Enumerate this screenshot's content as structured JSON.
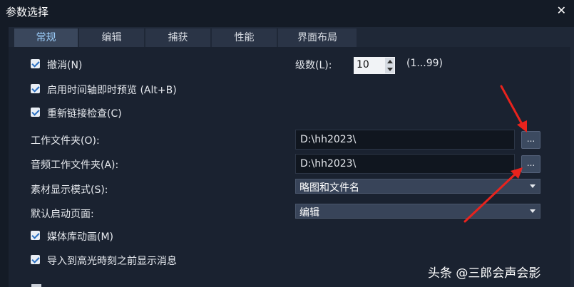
{
  "window": {
    "title": "参数选择",
    "close_glyph": "✕"
  },
  "tabs": [
    "常规",
    "编辑",
    "捕获",
    "性能",
    "界面布局"
  ],
  "general": {
    "undo": {
      "label": "撤消(N)",
      "checked": true
    },
    "levels": {
      "label": "级数(L):",
      "value": "10",
      "range": "(1...99)"
    },
    "instant_preview": {
      "label": "启用时间轴即时预览 (Alt+B)",
      "checked": true
    },
    "relink_check": {
      "label": "重新链接检查(C)",
      "checked": true
    },
    "work_folder": {
      "label": "工作文件夹(O):",
      "value": "D:\\hh2023\\",
      "button": "..."
    },
    "audio_work_folder": {
      "label": "音频工作文件夹(A):",
      "value": "D:\\hh2023\\",
      "button": "..."
    },
    "clip_display_mode": {
      "label": "素材显示模式(S):",
      "value": "略图和文件名"
    },
    "default_startup_page": {
      "label": "默认启动页面:",
      "value": "编辑"
    },
    "library_animation": {
      "label": "媒体库动画(M)",
      "checked": true
    },
    "show_message_before_highlight": {
      "label": "导入到高光時刻之前显示消息",
      "checked": true
    }
  },
  "watermark": "头条 @三郎会声会影",
  "colors": {
    "background": "#141b26",
    "panel": "#1a2230",
    "active_tab_text": "#9fd2ff",
    "annotation_arrow": "#e8231d"
  }
}
